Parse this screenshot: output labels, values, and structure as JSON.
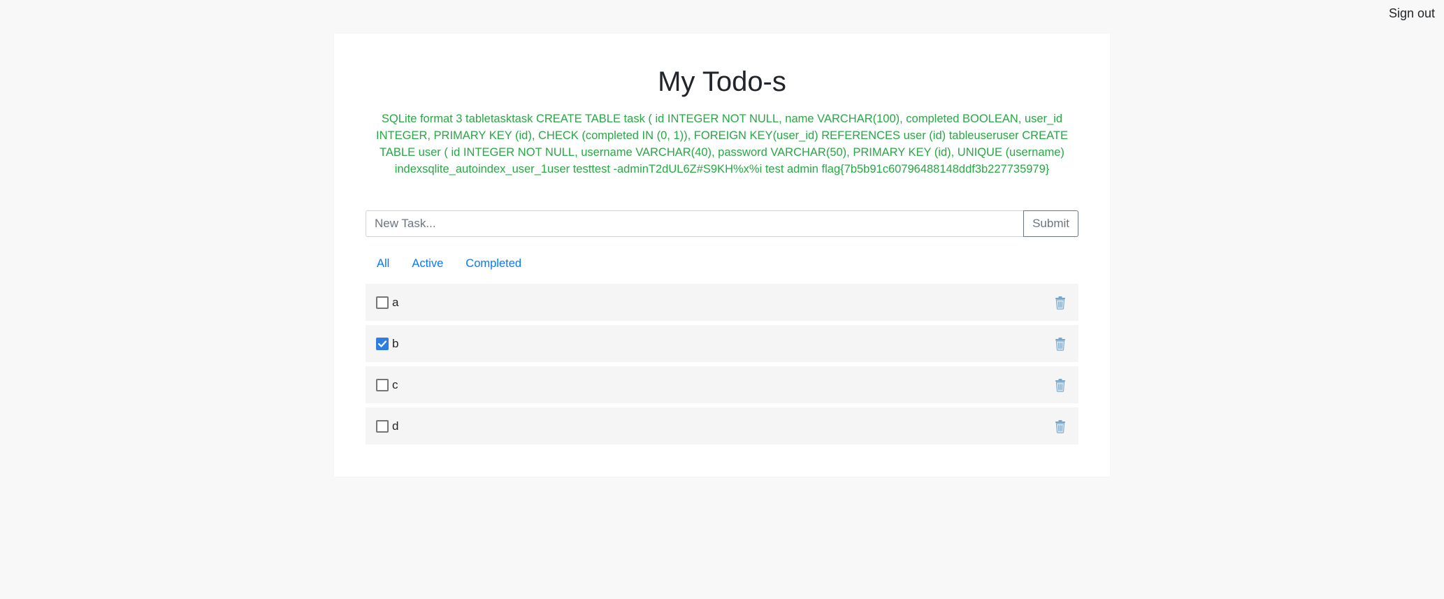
{
  "header": {
    "signout_label": "Sign out"
  },
  "main": {
    "title": "My Todo-s",
    "message": "SQLite format 3 tabletasktask CREATE TABLE task ( id INTEGER NOT NULL, name VARCHAR(100), completed BOOLEAN, user_id INTEGER, PRIMARY KEY (id), CHECK (completed IN (0, 1)), FOREIGN KEY(user_id) REFERENCES user (id) tableuseruser CREATE TABLE user ( id INTEGER NOT NULL, username VARCHAR(40), password VARCHAR(50), PRIMARY KEY (id), UNIQUE (username) indexsqlite_autoindex_user_1user testtest -adminT2dUL6Z#S9KH%x%i test admin flag{7b5b91c60796488148ddf3b227735979}",
    "form": {
      "placeholder": "New Task...",
      "value": "",
      "submit_label": "Submit"
    },
    "filters": [
      {
        "label": "All"
      },
      {
        "label": "Active"
      },
      {
        "label": "Completed"
      }
    ],
    "tasks": [
      {
        "name": "a",
        "completed": false,
        "icon": "trash-icon"
      },
      {
        "name": "b",
        "completed": true,
        "icon": "trash-icon"
      },
      {
        "name": "c",
        "completed": false,
        "icon": "trash-icon"
      },
      {
        "name": "d",
        "completed": false,
        "icon": "trash-icon"
      }
    ]
  },
  "colors": {
    "background": "#f8f8f8",
    "card": "#ffffff",
    "message_green": "#28a745",
    "link_blue": "#007bff",
    "checkbox_checked": "#2f7de1"
  }
}
